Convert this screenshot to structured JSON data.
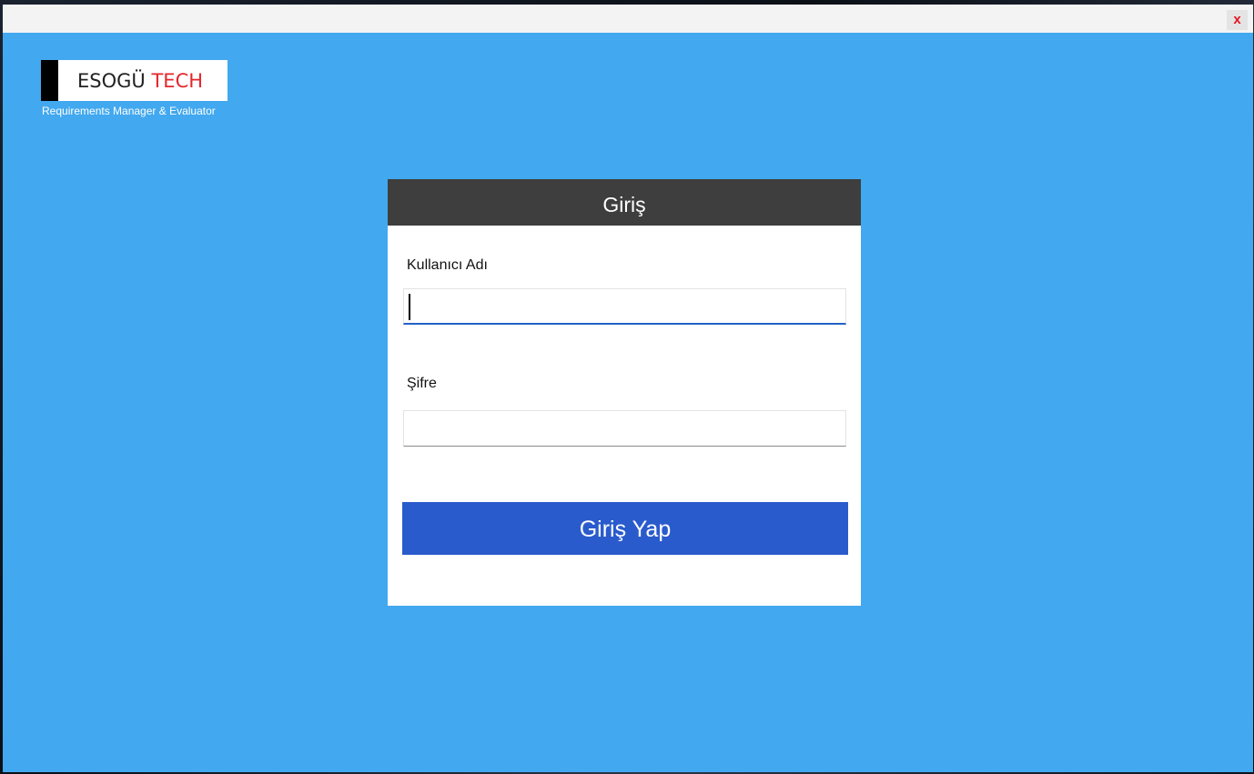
{
  "window": {
    "close_label": "x"
  },
  "logo": {
    "brand": "ESOGÜ",
    "accent": "TECH",
    "tagline": "Requirements Manager & Evaluator"
  },
  "login": {
    "title": "Giriş",
    "username_label": "Kullanıcı Adı",
    "username_value": "",
    "password_label": "Şifre",
    "password_value": "",
    "submit_label": "Giriş Yap"
  },
  "colors": {
    "window_bg": "#42a8ef",
    "header_bg": "#3e3e3e",
    "button_bg": "#2a5bcd",
    "accent_red": "#e5262c"
  },
  "icons": {
    "close": "close-icon"
  }
}
